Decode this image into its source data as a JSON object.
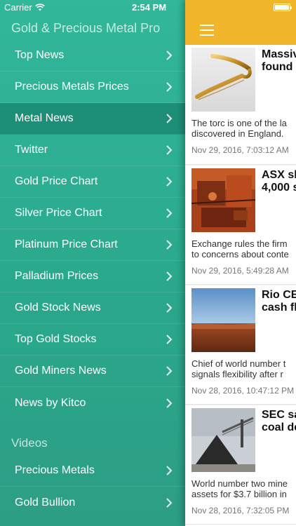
{
  "status_bar": {
    "carrier": "Carrier",
    "time": "2:54 PM"
  },
  "app_title": "Gold & Precious Metal Pro",
  "menu": {
    "items": [
      {
        "label": "Top News"
      },
      {
        "label": "Precious Metals Prices"
      },
      {
        "label": "Metal News"
      },
      {
        "label": "Twitter"
      },
      {
        "label": "Gold Price Chart"
      },
      {
        "label": "Silver Price Chart"
      },
      {
        "label": "Platinum Price Chart"
      },
      {
        "label": "Palladium Prices"
      },
      {
        "label": "Gold Stock News"
      },
      {
        "label": "Top Gold Stocks"
      },
      {
        "label": "Gold Miners News"
      },
      {
        "label": "News by Kitco"
      }
    ],
    "active": "Metal News"
  },
  "videos_section": {
    "title": "Videos",
    "items": [
      {
        "label": "Precious Metals"
      },
      {
        "label": "Gold Bullion"
      }
    ]
  },
  "articles": [
    {
      "headline_l1": "Massiv",
      "headline_l2": "found i",
      "excerpt_l1": "The torc is one of the la",
      "excerpt_l2": "discovered in England.",
      "timestamp": "Nov 29, 2016, 7:03:12 AM"
    },
    {
      "headline_l1": "ASX sla",
      "headline_l2": "4,000 s",
      "excerpt_l1": "Exchange rules the firm",
      "excerpt_l2": "to concerns about conte",
      "timestamp": "Nov 29, 2016, 5:49:28 AM"
    },
    {
      "headline_l1": "Rio CEC",
      "headline_l2": "cash fl",
      "excerpt_l1": "Chief of world number t",
      "excerpt_l2": "signals flexibility after r",
      "timestamp": "Nov 28, 2016, 10:47:12 PM"
    },
    {
      "headline_l1": "SEC sa",
      "headline_l2": "coal de",
      "excerpt_l1": "World number two mine",
      "excerpt_l2": "assets for $3.7 billion in",
      "timestamp": "Nov 28, 2016, 7:32:05 PM"
    }
  ],
  "colors": {
    "drawer_bg": "#2aa88c",
    "active_item_bg": "#1e8f77",
    "navbar_bg": "#f1b52a"
  },
  "icons": {
    "menu": "hamburger-icon",
    "chevron": "chevron-right-icon",
    "wifi": "wifi-icon",
    "battery": "battery-icon"
  }
}
